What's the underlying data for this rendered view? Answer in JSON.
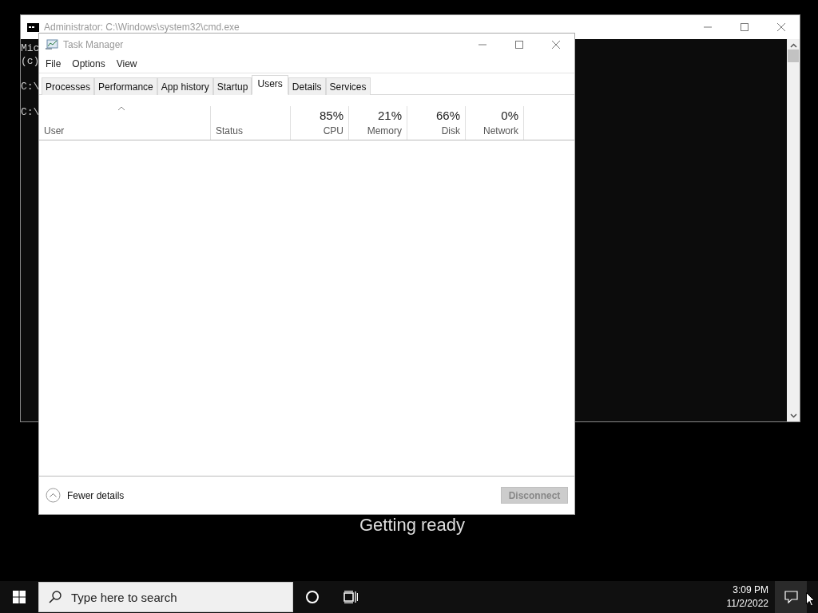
{
  "console_window": {
    "title": "Administrator: C:\\Windows\\system32\\cmd.exe",
    "blocks": [
      [
        "Mic",
        "(c)"
      ],
      [
        "C:\\"
      ],
      [
        "C:\\"
      ]
    ]
  },
  "task_manager": {
    "title": "Task Manager",
    "menu": [
      "File",
      "Options",
      "View"
    ],
    "tabs": [
      {
        "label": "Processes",
        "selected": false
      },
      {
        "label": "Performance",
        "selected": false
      },
      {
        "label": "App history",
        "selected": false
      },
      {
        "label": "Startup",
        "selected": false
      },
      {
        "label": "Users",
        "selected": true
      },
      {
        "label": "Details",
        "selected": false
      },
      {
        "label": "Services",
        "selected": false
      }
    ],
    "columns": [
      {
        "label": "User",
        "sorted": true
      },
      {
        "label": "Status",
        "sorted": false
      },
      {
        "label": "CPU",
        "value": "85%",
        "sorted": false
      },
      {
        "label": "Memory",
        "value": "21%",
        "sorted": false
      },
      {
        "label": "Disk",
        "value": "66%",
        "sorted": false
      },
      {
        "label": "Network",
        "value": "0%",
        "sorted": false
      }
    ],
    "footer": {
      "toggle": "Fewer details",
      "button": {
        "label": "Disconnect",
        "disabled": true
      }
    }
  },
  "desktop": {
    "status_text": "Getting ready"
  },
  "taskbar": {
    "search": {
      "placeholder": "Type here to search"
    },
    "time": "3:09 PM",
    "date": "11/2/2022"
  }
}
